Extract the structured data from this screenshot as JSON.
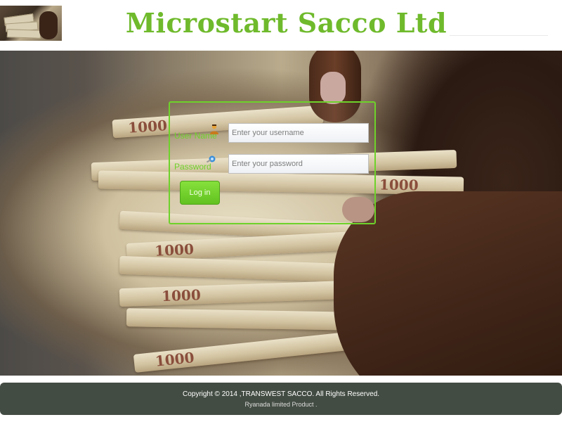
{
  "header": {
    "title": "Microstart Sacco Ltd"
  },
  "login": {
    "username_label": "User Name",
    "username_placeholder": "Enter your username",
    "username_value": "",
    "password_label": "Password",
    "password_placeholder": "Enter your password",
    "password_value": "",
    "submit_label": "Log in"
  },
  "hero": {
    "note_marks": [
      "1000",
      "1000",
      "1000",
      "1000",
      "1000"
    ]
  },
  "footer": {
    "copyright": "Copyright © 2014 ,TRANSWEST SACCO. All Rights Reserved.",
    "credit": "Ryanada limited Product ."
  },
  "colors": {
    "accent": "#6ed22a",
    "title": "#6fba2c",
    "footer_bg": "#434c43"
  },
  "icons": {
    "username": "user-icon",
    "password": "key-icon"
  }
}
